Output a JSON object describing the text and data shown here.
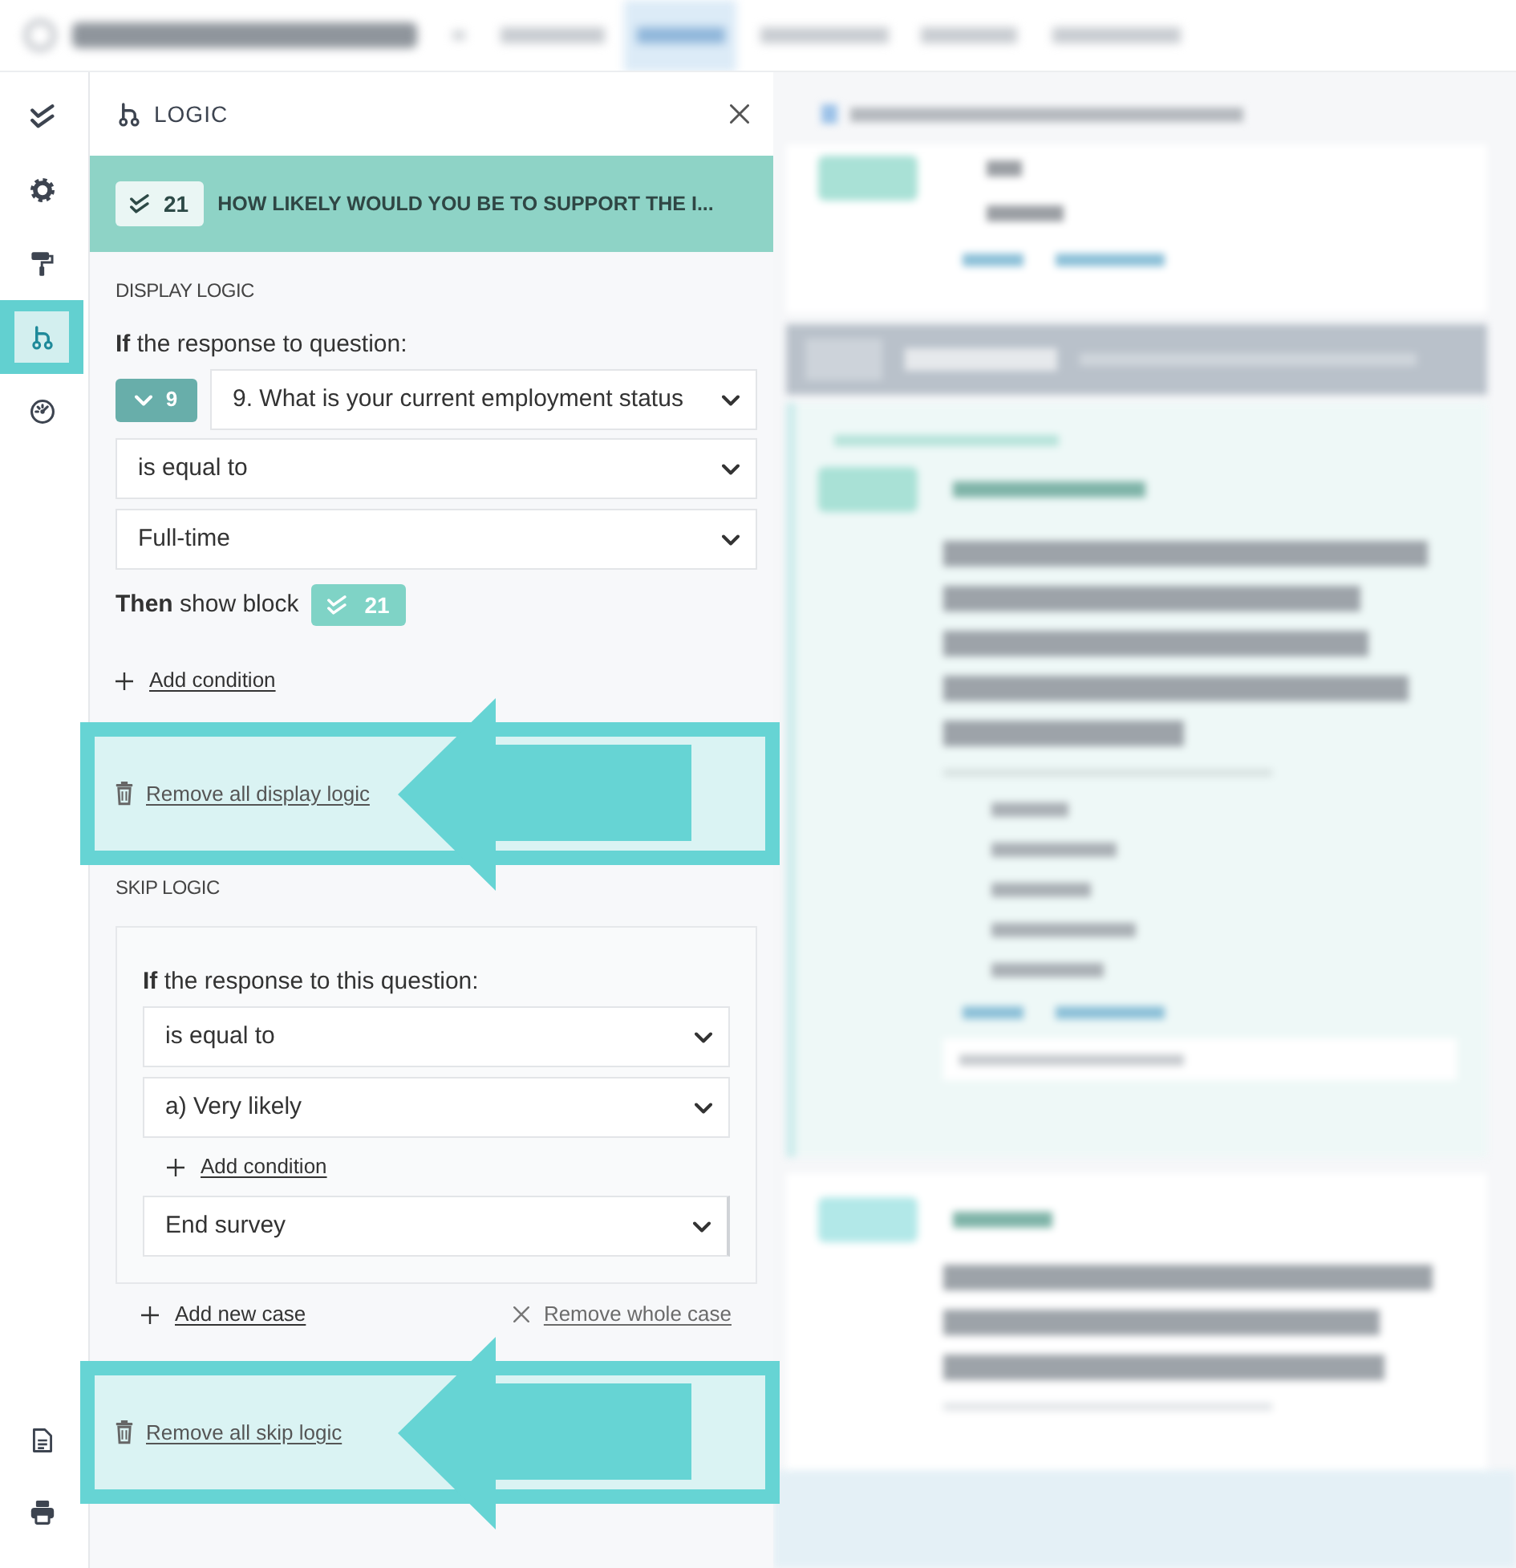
{
  "sidebar": {
    "items": [
      {
        "kind": "tasks",
        "selected": false
      },
      {
        "kind": "settings",
        "selected": false
      },
      {
        "kind": "design",
        "selected": false
      },
      {
        "kind": "logic",
        "selected": true
      },
      {
        "kind": "gauge",
        "selected": false
      }
    ],
    "footer_items": [
      {
        "kind": "document"
      },
      {
        "kind": "print"
      }
    ]
  },
  "panel": {
    "title": "LOGIC",
    "block": {
      "badge": "21",
      "title": "HOW LIKELY WOULD YOU BE TO SUPPORT THE I..."
    }
  },
  "display_logic": {
    "heading": "DISPLAY LOGIC",
    "condition_label": "**If** the response to question:",
    "question_badge": "9",
    "question": "9. What is your current employment status",
    "operator": "is equal to",
    "value": "Full-time",
    "then_label": "**Then** show block",
    "then_badge": "21",
    "add_condition": "Add condition",
    "remove_all": {
      "label": "Remove all display logic",
      "highlighted": true
    }
  },
  "skip_logic": {
    "heading": "SKIP LOGIC",
    "cases": [
      {
        "condition_label": "**If** the response to this question:",
        "operator": "is equal to",
        "value": "a) Very likely",
        "add_condition": "Add condition",
        "action": "End survey"
      }
    ],
    "add_case": "Add new case",
    "remove_case": "Remove whole case",
    "remove_all": {
      "label": "Remove all skip logic",
      "highlighted": true
    }
  }
}
